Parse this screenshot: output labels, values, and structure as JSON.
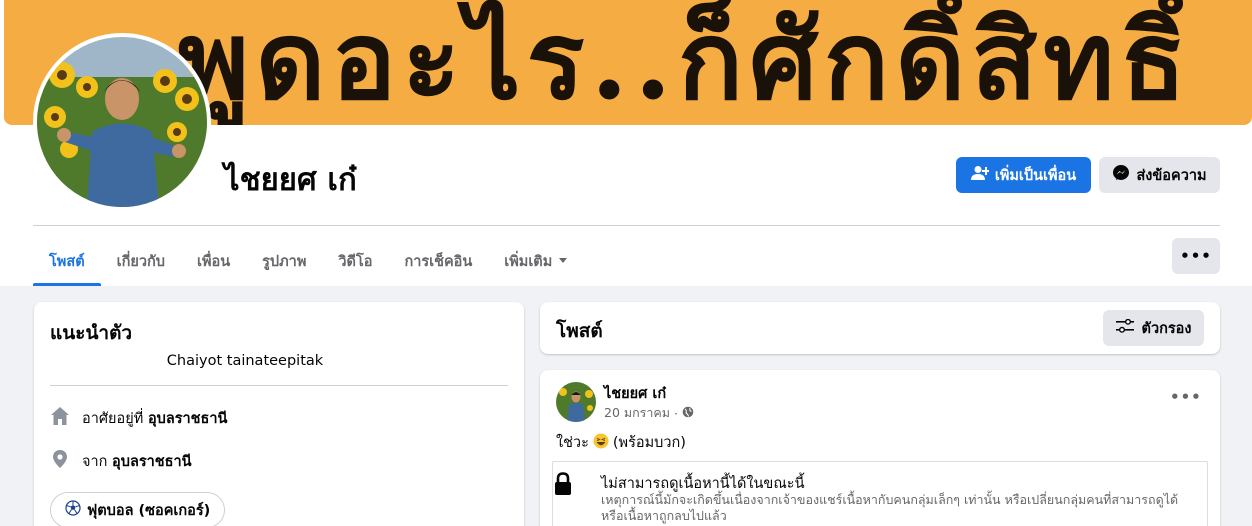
{
  "cover": {
    "text": "ะพูดอะไร..ก็ศักดิ์สิทธิ์"
  },
  "profile": {
    "name": "ไชยยศ เก๋"
  },
  "actions": {
    "add_friend_label": "เพิ่มเป็นเพื่อน",
    "message_label": "ส่งข้อความ"
  },
  "tabs": [
    {
      "label": "โพสต์"
    },
    {
      "label": "เกี่ยวกับ"
    },
    {
      "label": "เพื่อน"
    },
    {
      "label": "รูปภาพ"
    },
    {
      "label": "วิดีโอ"
    },
    {
      "label": "การเช็คอิน"
    },
    {
      "label": "เพิ่มเติม"
    }
  ],
  "more_menu_label": "•••",
  "intro": {
    "title": "แนะนำตัว",
    "bio": "Chaiyot tainateepitak",
    "lives_prefix": "อาศัยอยู่ที่",
    "lives_value": "อุบลราชธานี",
    "from_prefix": "จาก",
    "from_value": "อุบลราชธานี",
    "hobby": "ฟุตบอล (ซอคเกอร์)"
  },
  "posts": {
    "title": "โพสต์",
    "filter_label": "ตัวกรอง",
    "items": [
      {
        "author": "ไชยยศ เก๋",
        "date": "20 มกราคม",
        "separator": "·",
        "text_before": "ใช่วะ",
        "text_after": "(พร้อมบวก)",
        "more": "•••",
        "unavailable_title": "ไม่สามารถดูเนื้อหานี้ได้ในขณะนี้",
        "unavailable_desc": "เหตุการณ์นี้มักจะเกิดขึ้นเนื่องจากเจ้าของแชร์เนื้อหากับคนกลุ่มเล็กๆ เท่านั้น หรือเปลี่ยนกลุ่มคนที่สามารถดูได้ หรือเนื้อหาถูกลบไปแล้ว"
      }
    ]
  },
  "colors": {
    "accent": "#1b74e4",
    "cover": "#f5ad43",
    "background": "#f0f2f5"
  }
}
